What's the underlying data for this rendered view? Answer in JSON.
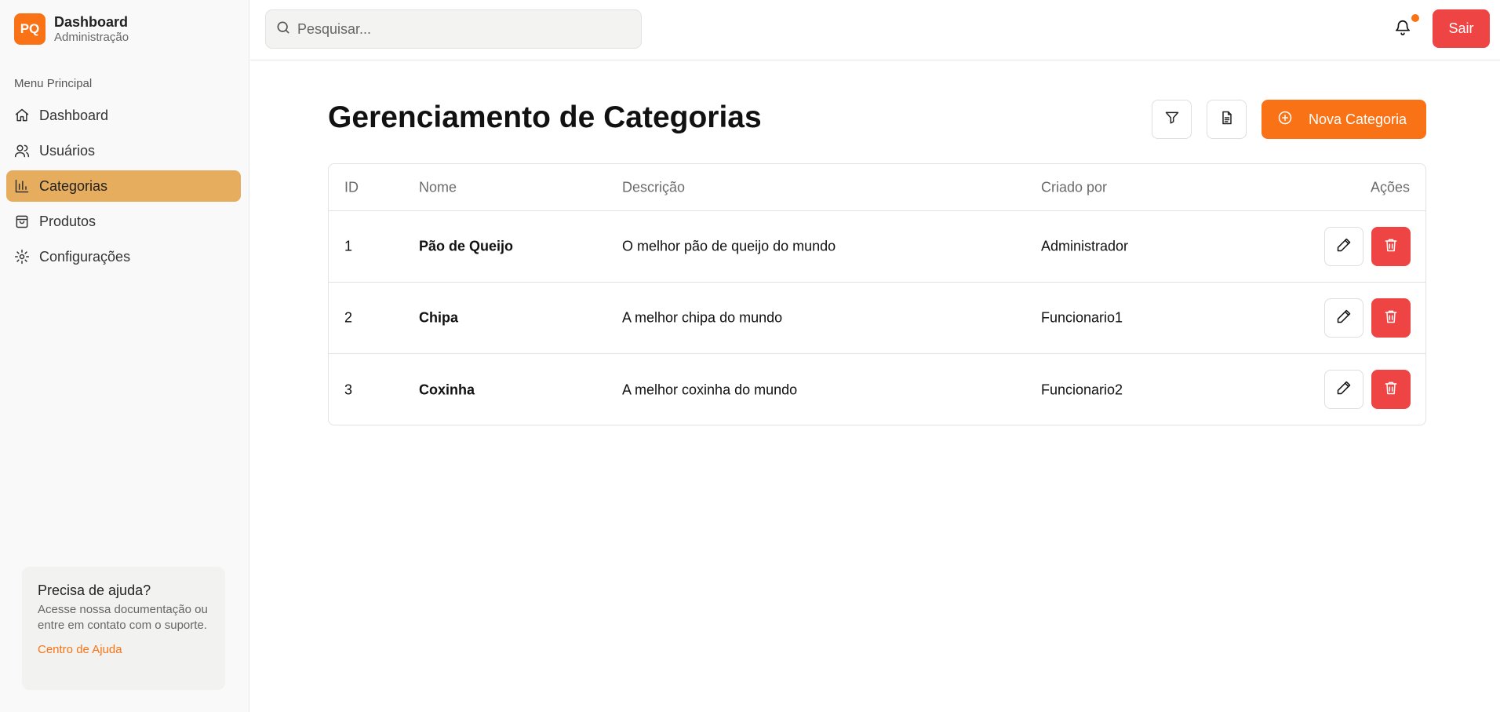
{
  "brand": {
    "logo": "PQ",
    "title": "Dashboard",
    "subtitle": "Administração"
  },
  "sidebar": {
    "menu_label": "Menu Principal",
    "items": [
      {
        "label": "Dashboard",
        "icon": "home-icon"
      },
      {
        "label": "Usuários",
        "icon": "users-icon"
      },
      {
        "label": "Categorias",
        "icon": "bar-chart-icon",
        "active": true
      },
      {
        "label": "Produtos",
        "icon": "shopping-bag-icon"
      },
      {
        "label": "Configurações",
        "icon": "gear-icon"
      }
    ],
    "help": {
      "title": "Precisa de ajuda?",
      "text": "Acesse nossa documentação ou entre em contato com o suporte.",
      "link": "Centro de Ajuda"
    }
  },
  "header": {
    "search_placeholder": "Pesquisar...",
    "logout_label": "Sair",
    "accent": "#f97316",
    "danger": "#ef4444"
  },
  "main": {
    "title": "Gerenciamento de Categorias",
    "new_button": "Nova Categoria",
    "table": {
      "columns": [
        "ID",
        "Nome",
        "Descrição",
        "Criado por",
        "Ações"
      ],
      "rows": [
        {
          "id": "1",
          "name": "Pão de Queijo",
          "description": "O melhor pão de queijo do mundo",
          "created_by": "Administrador"
        },
        {
          "id": "2",
          "name": "Chipa",
          "description": "A melhor chipa do mundo",
          "created_by": "Funcionario1"
        },
        {
          "id": "3",
          "name": "Coxinha",
          "description": "A melhor coxinha do mundo",
          "created_by": "Funcionario2"
        }
      ]
    }
  }
}
